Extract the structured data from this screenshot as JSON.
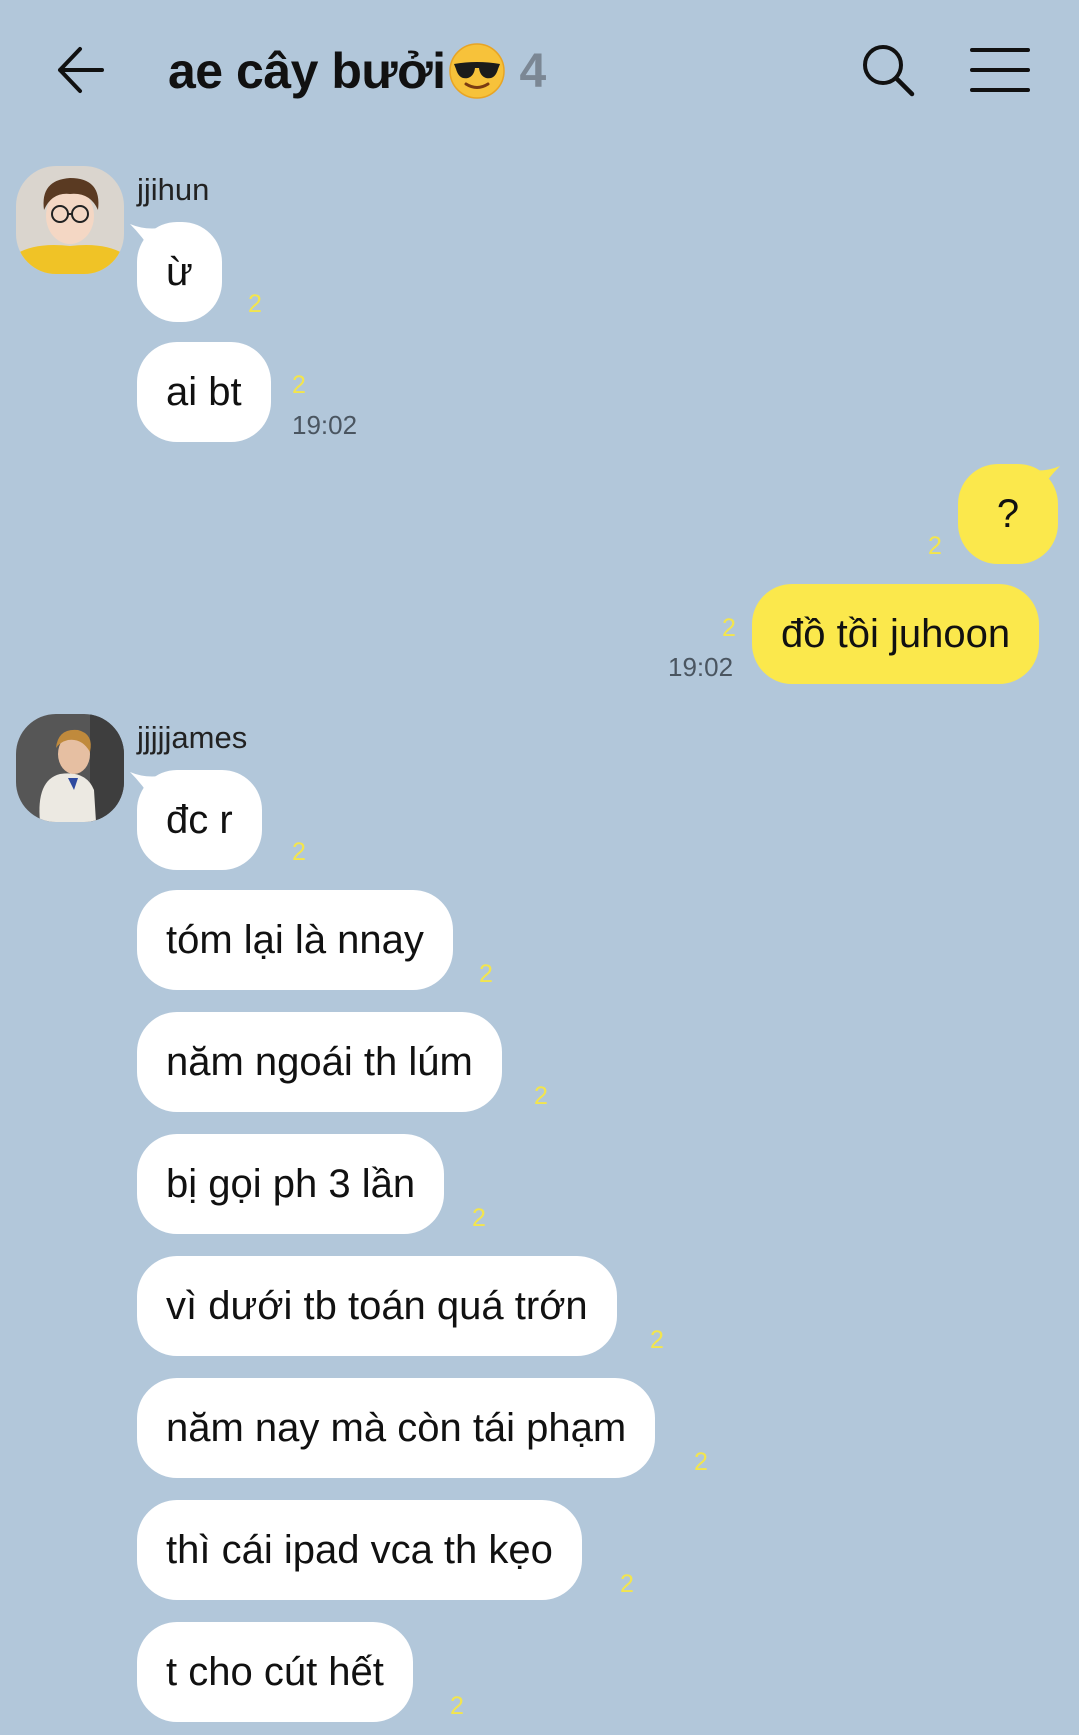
{
  "header": {
    "title": "ae cây bưởi",
    "member_count": "4"
  },
  "messages": {
    "jjihun": {
      "name": "jjihun",
      "msg1": "ừ",
      "msg2": "ai bt",
      "unread1": "2",
      "unread2": "2",
      "time": "19:02"
    },
    "me": {
      "msg1": "?",
      "msg2": "đồ tồi juhoon",
      "unread1": "2",
      "unread2": "2",
      "time": "19:02"
    },
    "james": {
      "name": "jjjjjames",
      "msgs": [
        "đc r",
        "tóm lại là nnay",
        "năm ngoái th lúm",
        "bị gọi ph 3 lần",
        "vì dưới tb toán quá trớn",
        "năm nay mà còn tái phạm",
        "thì cái ipad vca th kẹo",
        "t cho cút hết"
      ],
      "unread": [
        "2",
        "2",
        "2",
        "2",
        "2",
        "2",
        "2",
        "2"
      ]
    }
  },
  "colors": {
    "background": "#b2c7da",
    "incoming_bubble": "#ffffff",
    "outgoing_bubble": "#fbe84c",
    "unread_count": "#f3e54d"
  }
}
